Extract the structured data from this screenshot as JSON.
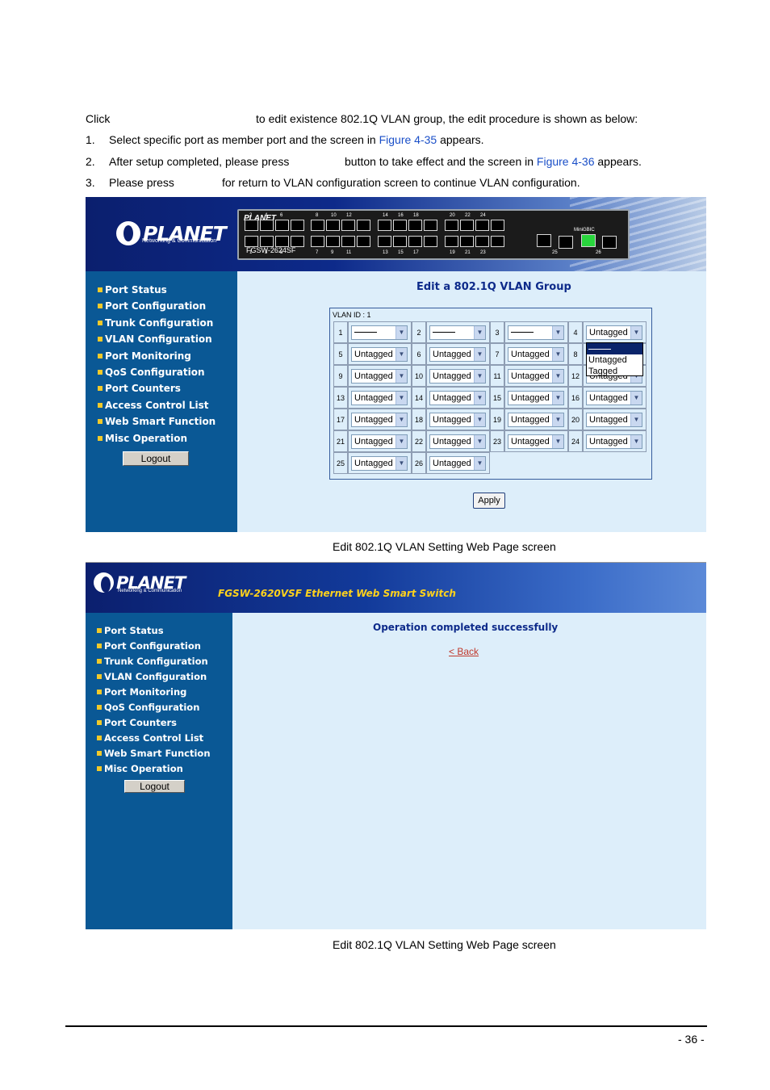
{
  "intro": {
    "click_word": "Click",
    "click_rest": "to edit existence 802.1Q VLAN group, the edit procedure is shown as below:"
  },
  "steps": [
    {
      "num": "1.",
      "before": "Select specific port as member port and the screen in",
      "link": "Figure 4-35",
      "after": "appears."
    },
    {
      "num": "2.",
      "before": "After setup completed, please press",
      "middle": "button to take effect and the screen in",
      "link": "Figure 4-36",
      "after": "appears."
    },
    {
      "num": "3.",
      "before": "Please press",
      "after": "for return to VLAN configuration screen to continue VLAN configuration."
    }
  ],
  "screen1": {
    "logo": "PLANET",
    "logo_sub": "Networking & Communication",
    "device_logo": "PLANET",
    "device_model": "FGSW-2624SF",
    "top_port_numbers": [
      "2",
      "4",
      "6",
      "8",
      "10",
      "12",
      "14",
      "16",
      "18",
      "20",
      "22",
      "24"
    ],
    "bottom_port_numbers": [
      "1",
      "3",
      "5",
      "7",
      "9",
      "11",
      "13",
      "15",
      "17",
      "19",
      "21",
      "23"
    ],
    "mini_gbic_label": "MiniGBIC",
    "sfp_labels": [
      "25",
      "26"
    ],
    "menu": [
      "Port Status",
      "Port Configuration",
      "Trunk Configuration",
      "VLAN Configuration",
      "Port Monitoring",
      "QoS Configuration",
      "Port Counters",
      "Access Control List",
      "Web Smart Function",
      "Misc Operation"
    ],
    "logout": "Logout",
    "title": "Edit a 802.1Q VLAN Group",
    "vlan_id": "VLAN ID : 1",
    "rows": [
      [
        {
          "port": "1",
          "value": "—"
        },
        {
          "port": "2",
          "value": "—"
        },
        {
          "port": "3",
          "value": "—"
        },
        {
          "port": "4",
          "value": "Untagged"
        }
      ],
      [
        {
          "port": "5",
          "value": "Untagged"
        },
        {
          "port": "6",
          "value": "Untagged"
        },
        {
          "port": "7",
          "value": "Untagged"
        },
        {
          "port": "8",
          "value": ""
        }
      ],
      [
        {
          "port": "9",
          "value": "Untagged"
        },
        {
          "port": "10",
          "value": "Untagged"
        },
        {
          "port": "11",
          "value": "Untagged"
        },
        {
          "port": "12",
          "value": "Untagged"
        }
      ],
      [
        {
          "port": "13",
          "value": "Untagged"
        },
        {
          "port": "14",
          "value": "Untagged"
        },
        {
          "port": "15",
          "value": "Untagged"
        },
        {
          "port": "16",
          "value": "Untagged"
        }
      ],
      [
        {
          "port": "17",
          "value": "Untagged"
        },
        {
          "port": "18",
          "value": "Untagged"
        },
        {
          "port": "19",
          "value": "Untagged"
        },
        {
          "port": "20",
          "value": "Untagged"
        }
      ],
      [
        {
          "port": "21",
          "value": "Untagged"
        },
        {
          "port": "22",
          "value": "Untagged"
        },
        {
          "port": "23",
          "value": "Untagged"
        },
        {
          "port": "24",
          "value": "Untagged"
        }
      ],
      [
        {
          "port": "25",
          "value": "Untagged"
        },
        {
          "port": "26",
          "value": "Untagged"
        }
      ]
    ],
    "dropdown_options": [
      "—",
      "Untagged",
      "Tagged"
    ],
    "apply": "Apply"
  },
  "caption1": "Edit 802.1Q VLAN Setting Web Page screen",
  "screen2": {
    "logo": "PLANET",
    "logo_sub": "Networking & Communication",
    "title": "FGSW-2620VSF Ethernet Web Smart Switch",
    "menu": [
      "Port Status",
      "Port Configuration",
      "Trunk Configuration",
      "VLAN Configuration",
      "Port Monitoring",
      "QoS Configuration",
      "Port Counters",
      "Access Control List",
      "Web Smart Function",
      "Misc Operation"
    ],
    "logout": "Logout",
    "message": "Operation completed successfully",
    "back": "< Back"
  },
  "caption2": "Edit 802.1Q VLAN Setting Web Page screen",
  "page_number": "- 36 -",
  "colors": {
    "link": "#1a4fc8",
    "sidebar": "#0a5895",
    "content_bg": "#ddeefa",
    "banner_dark": "#0b1f6e",
    "menu_bullet": "#f1c92a",
    "title_blue": "#0d2a8a",
    "back_link": "#c0392b",
    "sfp_active": "#29d63d"
  }
}
